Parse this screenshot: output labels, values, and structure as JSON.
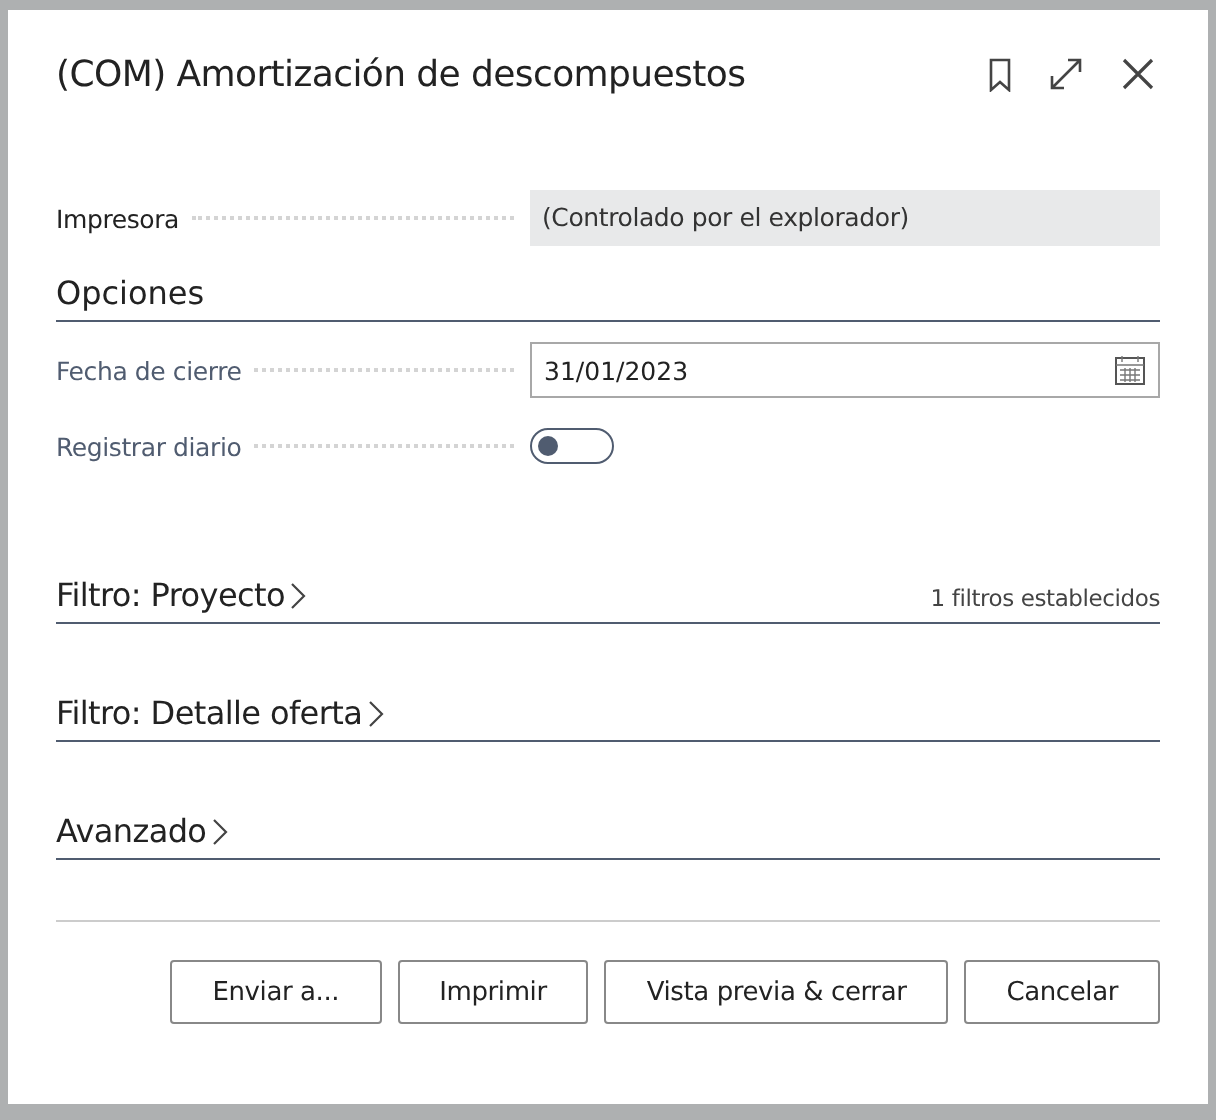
{
  "dialog": {
    "title": "(COM) Amortización de descompuestos"
  },
  "printer": {
    "label": "Impresora",
    "value": "(Controlado por el explorador)"
  },
  "options": {
    "title": "Opciones",
    "fields": [
      {
        "kind": "date",
        "label": "Fecha de cierre",
        "value": "31/01/2023"
      },
      {
        "kind": "toggle",
        "label": "Registrar diario",
        "on": false
      }
    ]
  },
  "sections": [
    {
      "title": "Filtro: Proyecto",
      "expanded": false,
      "summary": "1 filtros establecidos"
    },
    {
      "title": "Filtro: Detalle oferta",
      "expanded": false
    },
    {
      "title": "Avanzado",
      "expanded": false
    }
  ],
  "buttons": [
    "Enviar a...",
    "Imprimir",
    "Vista previa & cerrar",
    "Cancelar"
  ]
}
